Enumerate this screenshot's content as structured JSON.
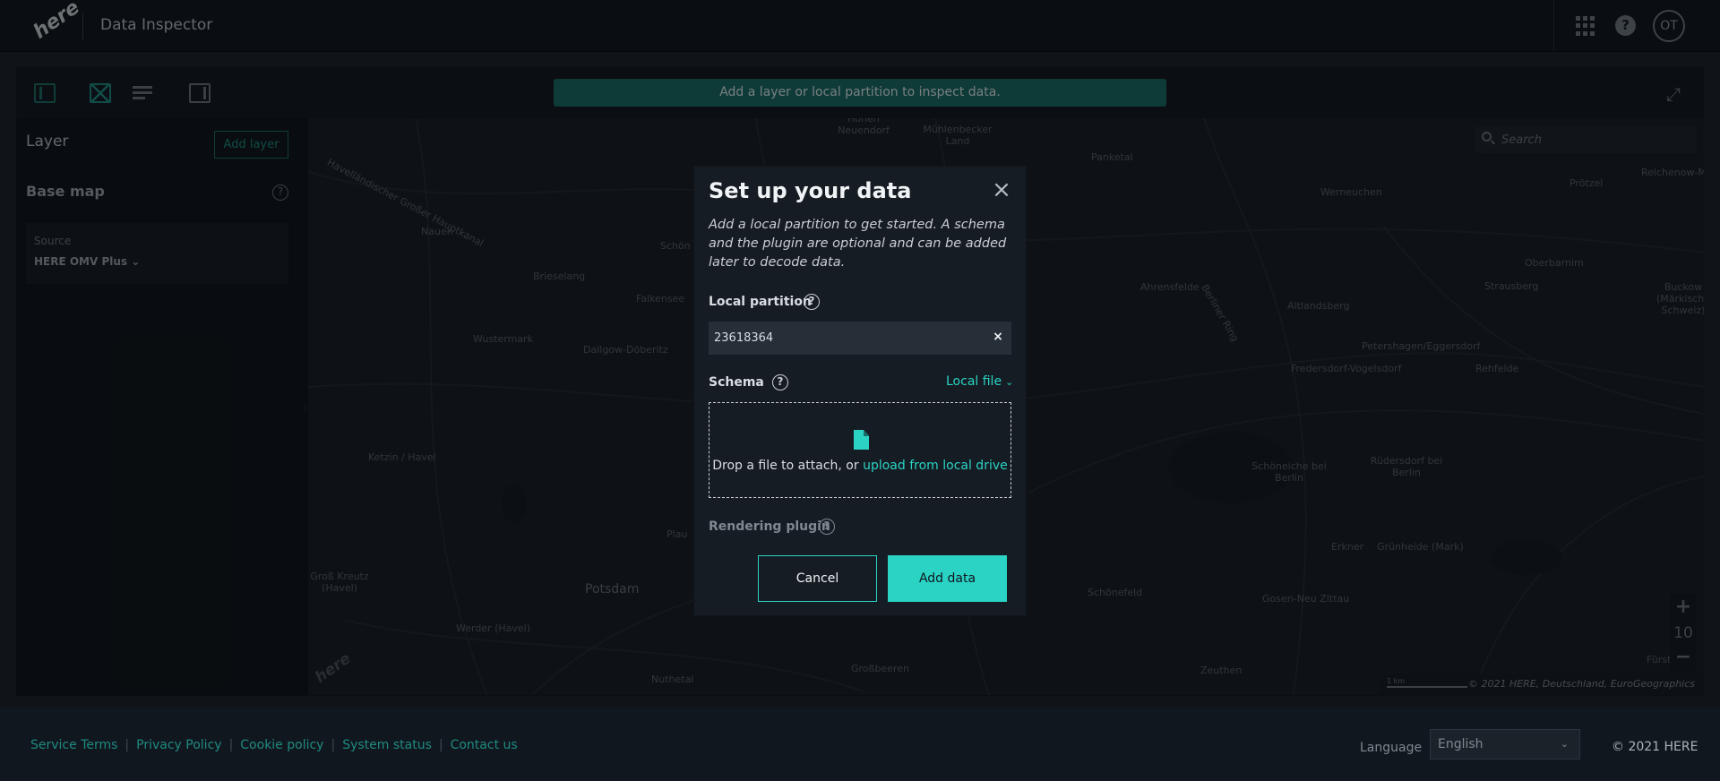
{
  "header": {
    "logo_text": "here",
    "app_title": "Data Inspector",
    "user_initials": "OT"
  },
  "toolbar": {
    "banner_text": "Add a layer or local partition to inspect data."
  },
  "left_panel": {
    "title": "Layer",
    "add_layer_label": "Add layer",
    "base_map_label": "Base map",
    "source_label": "Source",
    "source_value": "HERE OMV Plus"
  },
  "map": {
    "search_placeholder": "Search",
    "zoom_level": "10",
    "zoom_in": "+",
    "zoom_out": "−",
    "scale_label": "1 km",
    "attribution": "© 2021 HERE, Deutschland, EuroGeographics",
    "place_labels": [
      "Havelländischer Großer Hauptkanal",
      "Nauen",
      "Brieselang",
      "Falkensee",
      "Wustermark",
      "Dallgow-Döberitz",
      "Ketzin / Havel",
      "Potsdam",
      "Werder (Havel)",
      "Groß Kreutz (Havel)",
      "Nuthetal",
      "Großbeeren",
      "Hohen Neuendorf",
      "Mühlenbecker Land",
      "Panketal",
      "Werneuchen",
      "Prötzel",
      "Reichenow-M",
      "Ahrensfelde",
      "Altlandsberg",
      "Strausberg",
      "Oberbarnim",
      "Buckow (Märkische Schweiz)",
      "Petershagen/Eggersdorf",
      "Fredersdorf-Vogelsdorf",
      "Rehfelde",
      "Schöneiche bei Berlin",
      "Rüdersdorf bei Berlin",
      "Erkner",
      "Grünheide (Mark)",
      "Gosen-Neu Zittau",
      "Schönefeld",
      "Zeuthen",
      "Fürstenwa",
      "Berliner Ring",
      "Schön",
      "Plau"
    ]
  },
  "modal": {
    "title": "Set up your data",
    "close_icon": "×",
    "description": "Add a local partition to get started. A schema and the plugin are optional and can be added later to decode data.",
    "local_partition_label": "Local partition",
    "partition_value": "23618364",
    "clear_icon": "×",
    "schema_label": "Schema",
    "schema_source": "Local file",
    "drop_text": "Drop a file to attach, or",
    "drop_link": "upload from local drive",
    "rendering_plugin_label": "Rendering plugin",
    "cancel_label": "Cancel",
    "add_data_label": "Add data"
  },
  "footer": {
    "links": [
      "Service Terms",
      "Privacy Policy",
      "Cookie policy",
      "System status",
      "Contact us"
    ],
    "language_label": "Language",
    "language_value": "English",
    "copyright": "© 2021 HERE"
  },
  "colors": {
    "accent": "#2ad3c4",
    "accent_dark": "#1a6b66",
    "header_bg": "#131a22",
    "modal_bg": "#161c23"
  }
}
